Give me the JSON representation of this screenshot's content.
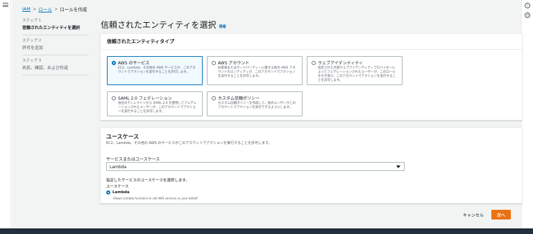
{
  "breadcrumb": {
    "iam": "IAM",
    "roles": "ロール",
    "current": "ロールを作成",
    "sep": ">"
  },
  "steps": [
    {
      "num": "ステップ 1",
      "title": "信頼されたエンティティを選択"
    },
    {
      "num": "ステップ 2",
      "title": "許可を追加"
    },
    {
      "num": "ステップ 3",
      "title": "名前、確認、および作成"
    }
  ],
  "page": {
    "title": "信頼されたエンティティを選択",
    "info": "情報"
  },
  "trusted_entity": {
    "heading": "信頼されたエンティティタイプ",
    "tiles": [
      {
        "title": "AWS のサービス",
        "desc": "EC2、Lambda、その他の AWS サービスが、このアカウントでアクションを実行することを許可します。"
      },
      {
        "title": "AWS アカウント",
        "desc": "お客様またはサードパーティーに属する他の AWS アカウントのエンティティが、このアカウントでアクションを実行することを許可します。"
      },
      {
        "title": "ウェブアイデンティティ",
        "desc": "指定された外部ウェブアイデンティティプロバイダーによってフェデレーションされたユーザーが、このロールを引き受け、このアカウントでアクションを実行することを許可します。"
      },
      {
        "title": "SAML 2.0 フェデレーション",
        "desc": "会社のディレクトリから SAML 2.0 を使用してフェデレーションされたユーザーが、このアカウントでアクションを実行することを許可します。"
      },
      {
        "title": "カスタム信頼ポリシー",
        "desc": "カスタム信頼ポリシーを作成して、他のユーザーがこのアカウントでアクションを実行できるようにします。"
      }
    ],
    "selected_index": 0
  },
  "use_case": {
    "title": "ユースケース",
    "desc": "EC2、Lambda、その他の AWS のサービスがこのアカウントでアクションを実行することを許可します。",
    "service_label": "サービスまたはユースケース",
    "service_value": "Lambda",
    "hint": "指定したサービスのユースケースを選択します。",
    "sub_label": "ユースケース",
    "option_label": "Lambda",
    "option_desc": "Allows Lambda functions to call AWS services on your behalf."
  },
  "footer": {
    "cancel": "キャンセル",
    "next": "次へ"
  },
  "colors": {
    "accent": "#0073bb",
    "primary_button": "#ec7211",
    "background": "#f2f3f3"
  },
  "icons": {
    "menu": "menu-icon",
    "info": "info-icon",
    "settings": "gear-icon"
  }
}
